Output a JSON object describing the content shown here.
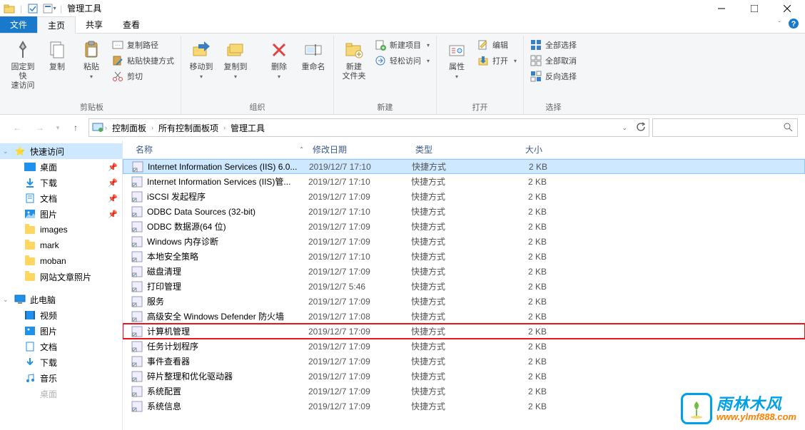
{
  "window": {
    "title": "管理工具"
  },
  "tabs": {
    "file": "文件",
    "home": "主页",
    "share": "共享",
    "view": "查看"
  },
  "ribbon": {
    "clipboard": {
      "label": "剪贴板",
      "pin": "固定到快\n速访问",
      "copy": "复制",
      "paste": "粘贴",
      "copypath": "复制路径",
      "pasteshortcut": "粘贴快捷方式",
      "cut": "剪切"
    },
    "organize": {
      "label": "组织",
      "moveto": "移动到",
      "copyto": "复制到",
      "delete": "删除",
      "rename": "重命名"
    },
    "new": {
      "label": "新建",
      "newfolder": "新建\n文件夹",
      "newitem": "新建项目",
      "easyaccess": "轻松访问"
    },
    "open": {
      "label": "打开",
      "properties": "属性",
      "edit": "编辑",
      "open": "打开"
    },
    "select": {
      "label": "选择",
      "selectall": "全部选择",
      "selectnone": "全部取消",
      "invert": "反向选择"
    }
  },
  "breadcrumb": {
    "seg1": "控制面板",
    "seg2": "所有控制面板项",
    "seg3": "管理工具"
  },
  "search": {
    "icon": "search"
  },
  "sidebar": {
    "quick": "快速访问",
    "desktop": "桌面",
    "downloads": "下载",
    "documents": "文档",
    "pictures": "图片",
    "images": "images",
    "mark": "mark",
    "moban": "moban",
    "webphotos": "网站文章照片",
    "thispc": "此电脑",
    "videos": "视频",
    "pictures2": "图片",
    "documents2": "文档",
    "downloads2": "下载",
    "music": "音乐",
    "desktop2": "桌面"
  },
  "columns": {
    "name": "名称",
    "date": "修改日期",
    "type": "类型",
    "size": "大小"
  },
  "rows": [
    {
      "name": "Internet Information Services (IIS) 6.0...",
      "date": "2019/12/7 17:10",
      "type": "快捷方式",
      "size": "2 KB",
      "sel": true
    },
    {
      "name": "Internet Information Services (IIS)管...",
      "date": "2019/12/7 17:10",
      "type": "快捷方式",
      "size": "2 KB"
    },
    {
      "name": "iSCSI 发起程序",
      "date": "2019/12/7 17:09",
      "type": "快捷方式",
      "size": "2 KB"
    },
    {
      "name": "ODBC Data Sources (32-bit)",
      "date": "2019/12/7 17:10",
      "type": "快捷方式",
      "size": "2 KB"
    },
    {
      "name": "ODBC 数据源(64 位)",
      "date": "2019/12/7 17:09",
      "type": "快捷方式",
      "size": "2 KB"
    },
    {
      "name": "Windows 内存诊断",
      "date": "2019/12/7 17:09",
      "type": "快捷方式",
      "size": "2 KB"
    },
    {
      "name": "本地安全策略",
      "date": "2019/12/7 17:10",
      "type": "快捷方式",
      "size": "2 KB"
    },
    {
      "name": "磁盘清理",
      "date": "2019/12/7 17:09",
      "type": "快捷方式",
      "size": "2 KB"
    },
    {
      "name": "打印管理",
      "date": "2019/12/7 5:46",
      "type": "快捷方式",
      "size": "2 KB"
    },
    {
      "name": "服务",
      "date": "2019/12/7 17:09",
      "type": "快捷方式",
      "size": "2 KB"
    },
    {
      "name": "高级安全 Windows Defender 防火墙",
      "date": "2019/12/7 17:08",
      "type": "快捷方式",
      "size": "2 KB"
    },
    {
      "name": "计算机管理",
      "date": "2019/12/7 17:09",
      "type": "快捷方式",
      "size": "2 KB",
      "hl": true
    },
    {
      "name": "任务计划程序",
      "date": "2019/12/7 17:09",
      "type": "快捷方式",
      "size": "2 KB"
    },
    {
      "name": "事件查看器",
      "date": "2019/12/7 17:09",
      "type": "快捷方式",
      "size": "2 KB"
    },
    {
      "name": "碎片整理和优化驱动器",
      "date": "2019/12/7 17:09",
      "type": "快捷方式",
      "size": "2 KB"
    },
    {
      "name": "系统配置",
      "date": "2019/12/7 17:09",
      "type": "快捷方式",
      "size": "2 KB"
    },
    {
      "name": "系统信息",
      "date": "2019/12/7 17:09",
      "type": "快捷方式",
      "size": "2 KB"
    }
  ],
  "watermark": {
    "t1": "雨林木风",
    "t2": "www.ylmf888.com"
  }
}
